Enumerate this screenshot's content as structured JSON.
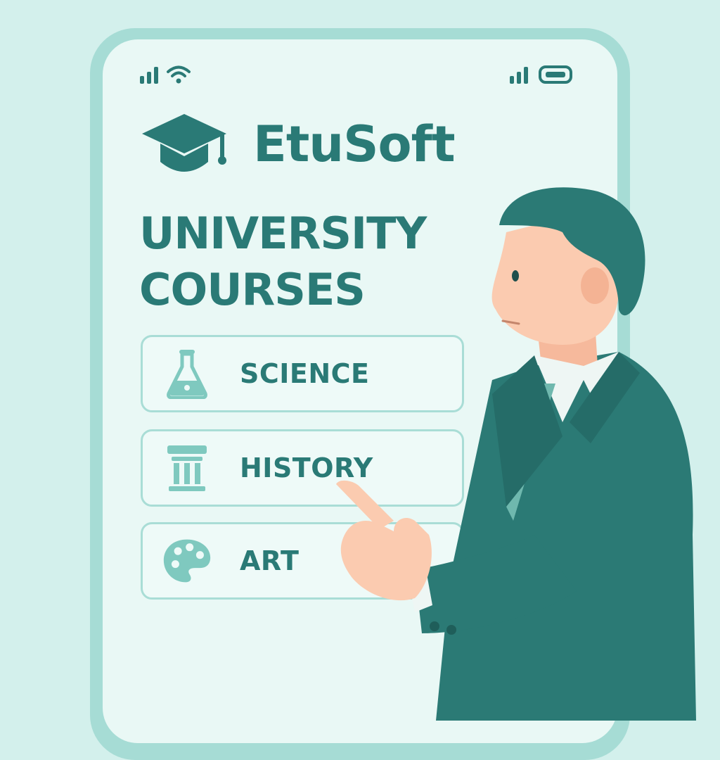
{
  "app": {
    "name": "EtuSoft",
    "headline": "UNIVERSITY COURSES"
  },
  "status_bar": {
    "icons": [
      "signal-icon",
      "wifi-icon",
      "signal-icon",
      "battery-icon"
    ]
  },
  "courses": [
    {
      "label": "SCIENCE",
      "icon": "flask-icon"
    },
    {
      "label": "HISTORY",
      "icon": "column-icon"
    },
    {
      "label": "ART",
      "icon": "palette-icon"
    }
  ],
  "colors": {
    "background": "#d3f0ec",
    "phone_frame": "#a6dcd5",
    "screen": "#e9f8f5",
    "primary": "#2a7a76",
    "icon_light": "#7fc9bf",
    "card_border": "#a9ddd6",
    "suit": "#2b7a75",
    "skin": "#fbcbb0"
  }
}
